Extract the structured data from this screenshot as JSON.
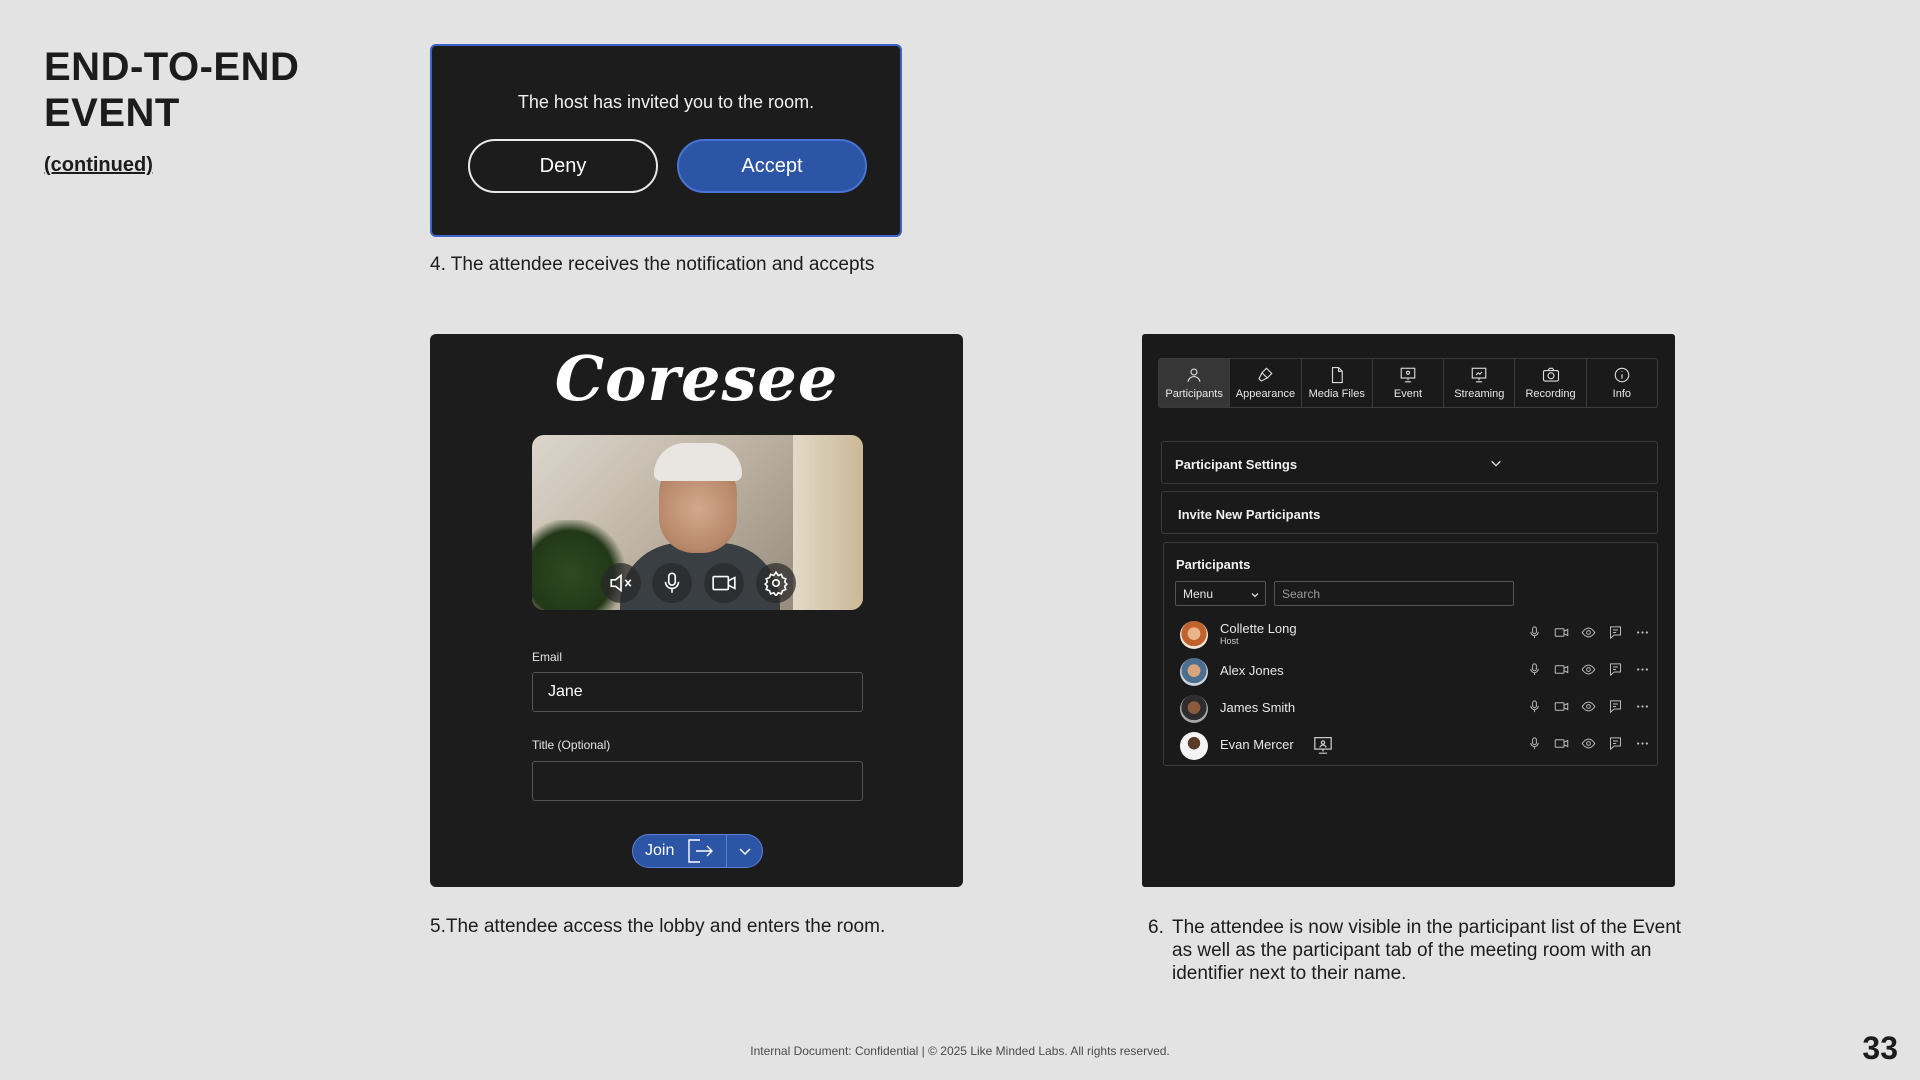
{
  "slide": {
    "title": "END-TO-END EVENT",
    "subtitle": "(continued)",
    "page_number": "33",
    "footer": "Internal Document: Confidential  |  © 2025 Like Minded Labs. All rights reserved."
  },
  "step4": {
    "message": "The host has invited you to the room.",
    "deny_label": "Deny",
    "accept_label": "Accept",
    "caption": "4. The attendee receives the notification and accepts"
  },
  "step5": {
    "logo": "Coresee",
    "email_label": "Email",
    "email_value": "Jane",
    "title_label": "Title (Optional)",
    "title_value": "",
    "join_label": "Join",
    "caption": "5.The attendee access the lobby and enters the room."
  },
  "step6": {
    "tabs": [
      {
        "label": "Participants",
        "icon": "person-icon",
        "active": true
      },
      {
        "label": "Appearance",
        "icon": "paint-brush-icon",
        "active": false
      },
      {
        "label": "Media Files",
        "icon": "file-icon",
        "active": false
      },
      {
        "label": "Event",
        "icon": "presentation-icon",
        "active": false
      },
      {
        "label": "Streaming",
        "icon": "streaming-icon",
        "active": false
      },
      {
        "label": "Recording",
        "icon": "camera-icon",
        "active": false
      },
      {
        "label": "Info",
        "icon": "info-icon",
        "active": false
      }
    ],
    "participant_settings": "Participant Settings",
    "invite_new": "Invite New Participants",
    "participants_title": "Participants",
    "menu_label": "Menu",
    "search_placeholder": "Search",
    "participants": [
      {
        "name": "Collette Long",
        "role": "Host"
      },
      {
        "name": "Alex Jones",
        "role": ""
      },
      {
        "name": "James Smith",
        "role": ""
      },
      {
        "name": "Evan Mercer",
        "role": "",
        "identifier": "presenter-screen-icon"
      }
    ],
    "caption_number": "6.",
    "caption_text": "The attendee is now visible in the participant list of the Event as well as the participant tab of the meeting room with an identifier next to their name."
  },
  "colors": {
    "background": "#e3e3e3",
    "dark_panel": "#1c1c1c",
    "accent_blue": "#2c55a6",
    "dialog_border": "#3a64c8"
  }
}
